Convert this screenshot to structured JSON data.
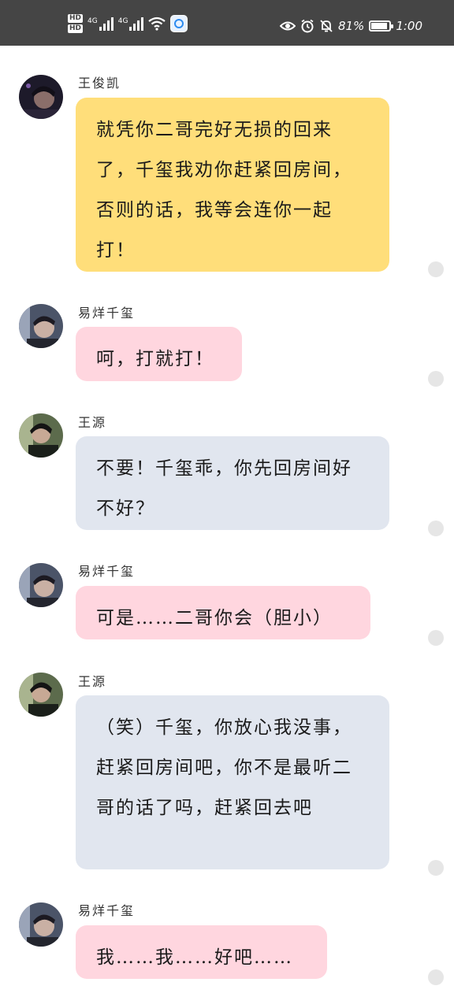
{
  "status_bar": {
    "hd1": "HD",
    "hd2": "HD",
    "net1": "4G",
    "net2": "4G",
    "battery_percent": "81%",
    "battery_level": 0.81,
    "time": "1:00",
    "icons": [
      "hd-icon",
      "signal-icon",
      "wifi-icon",
      "app-icon",
      "eye-icon",
      "alarm-icon",
      "mute-icon",
      "battery-icon"
    ]
  },
  "colors": {
    "yellow_bubble": "#ffde7a",
    "pink_bubble": "#ffd6df",
    "gray_bubble": "#e1e6ef",
    "status_bar": "#454545"
  },
  "messages": [
    {
      "name": "王俊凯",
      "text": "就凭你二哥完好无损的回来了，千玺我劝你赶紧回房间，否则的话，我等会连你一起打！",
      "color": "yellow"
    },
    {
      "name": "易烊千玺",
      "text": "呵，打就打！",
      "color": "pink"
    },
    {
      "name": "王源",
      "text": "不要！千玺乖，你先回房间好不好？",
      "color": "gray"
    },
    {
      "name": "易烊千玺",
      "text": "可是……二哥你会（胆小）",
      "color": "pink"
    },
    {
      "name": "王源",
      "text": "（笑）千玺，你放心我没事，赶紧回房间吧，你不是最听二哥的话了吗，赶紧回去吧",
      "color": "gray"
    },
    {
      "name": "易烊千玺",
      "text": "我……我……好吧……",
      "color": "pink"
    }
  ]
}
